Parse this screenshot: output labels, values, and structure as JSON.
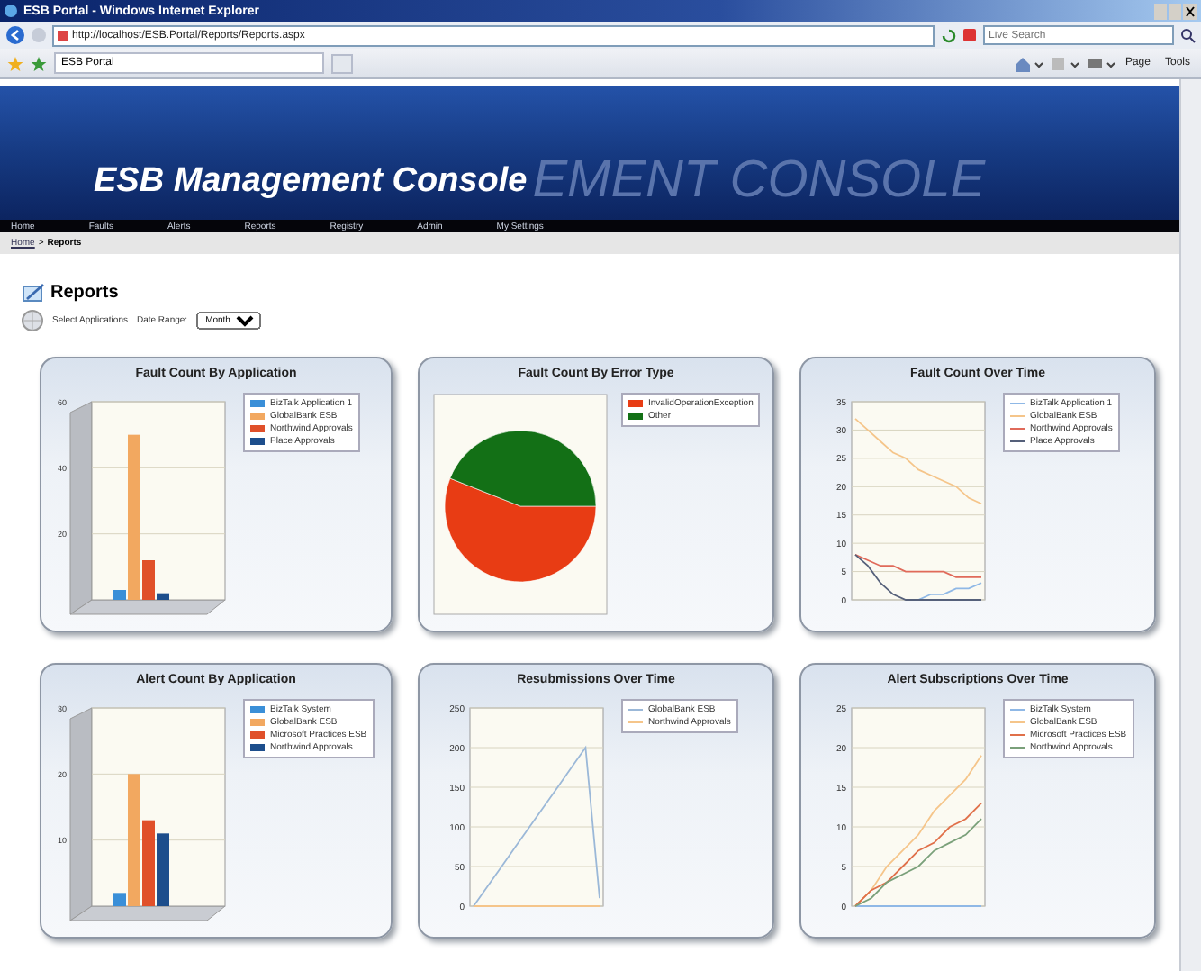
{
  "window": {
    "title": "ESB Portal - Windows Internet Explorer"
  },
  "address_bar": {
    "url": "http://localhost/ESB.Portal/Reports/Reports.aspx"
  },
  "search": {
    "placeholder": "Live Search"
  },
  "tab": {
    "label": "ESB Portal"
  },
  "toolbar": [
    "Page",
    "Tools"
  ],
  "banner": {
    "title": "ESB Management Console",
    "backdrop": "EMENT CONSOLE"
  },
  "nav": [
    "Home",
    "Faults",
    "Alerts",
    "Reports",
    "Registry",
    "Admin",
    "My Settings"
  ],
  "breadcrumb": {
    "link": "Home",
    "separator": ">",
    "current": "Reports"
  },
  "page": {
    "title": "Reports",
    "select_label": "Select Applications",
    "date_label": "Date Range:",
    "date_value": "Month"
  },
  "cards": [
    {
      "title": "Fault Count By Application",
      "chart_data": {
        "type": "bar",
        "grid": true,
        "legend": true,
        "ylim": [
          0,
          60
        ],
        "yticks": [
          20,
          40,
          60
        ],
        "series": [
          {
            "name": "BizTalk Application 1",
            "color": "#3a8fd8",
            "values": [
              3
            ]
          },
          {
            "name": "GlobalBank ESB",
            "color": "#f2a860",
            "values": [
              50
            ]
          },
          {
            "name": "Northwind Approvals",
            "color": "#e0502a",
            "values": [
              12
            ]
          },
          {
            "name": "Place Approvals",
            "color": "#1d4e8c",
            "values": [
              2
            ]
          }
        ]
      }
    },
    {
      "title": "Fault Count By Error Type",
      "chart_data": {
        "type": "pie",
        "legend": true,
        "categories": [
          "InvalidOperationException",
          "Other"
        ],
        "colors": [
          "#e83c14",
          "#137016"
        ],
        "values": [
          56,
          44
        ]
      }
    },
    {
      "title": "Fault Count Over Time",
      "chart_data": {
        "type": "line",
        "grid": true,
        "legend": true,
        "ylim": [
          0,
          35
        ],
        "yticks": [
          0,
          5,
          10,
          15,
          20,
          25,
          30,
          35
        ],
        "series": [
          {
            "name": "BizTalk Application 1",
            "color": "#8fb8e6",
            "values": [
              null,
              null,
              null,
              null,
              0,
              0,
              1,
              1,
              2,
              2,
              3
            ]
          },
          {
            "name": "GlobalBank ESB",
            "color": "#f5c58a",
            "values": [
              32,
              30,
              28,
              26,
              25,
              23,
              22,
              21,
              20,
              18,
              17
            ]
          },
          {
            "name": "Northwind Approvals",
            "color": "#e06a5a",
            "values": [
              8,
              7,
              6,
              6,
              5,
              5,
              5,
              5,
              4,
              4,
              4
            ]
          },
          {
            "name": "Place Approvals",
            "color": "#55607a",
            "values": [
              8,
              6,
              3,
              1,
              0,
              0,
              0,
              0,
              0,
              0,
              0
            ]
          }
        ]
      }
    },
    {
      "title": "Alert Count By Application",
      "chart_data": {
        "type": "bar",
        "grid": true,
        "legend": true,
        "ylim": [
          0,
          30
        ],
        "yticks": [
          10,
          20,
          30
        ],
        "series": [
          {
            "name": "BizTalk System",
            "color": "#3a8fd8",
            "values": [
              2
            ]
          },
          {
            "name": "GlobalBank ESB",
            "color": "#f2a860",
            "values": [
              20
            ]
          },
          {
            "name": "Microsoft Practices ESB",
            "color": "#e0502a",
            "values": [
              13
            ]
          },
          {
            "name": "Northwind Approvals",
            "color": "#1d4e8c",
            "values": [
              11
            ]
          }
        ]
      }
    },
    {
      "title": "Resubmissions Over Time",
      "chart_data": {
        "type": "line",
        "grid": true,
        "legend": true,
        "ylim": [
          0,
          250
        ],
        "yticks": [
          0,
          50,
          100,
          150,
          200,
          250
        ],
        "series": [
          {
            "name": "GlobalBank ESB",
            "color": "#9bb8d8",
            "values": [
              0,
              25,
              50,
              75,
              100,
              125,
              150,
              175,
              200,
              10
            ]
          },
          {
            "name": "Northwind Approvals",
            "color": "#f5c58a",
            "values": [
              0,
              0,
              0,
              0,
              0,
              0,
              0,
              0,
              0,
              0
            ]
          }
        ]
      }
    },
    {
      "title": "Alert Subscriptions Over Time",
      "chart_data": {
        "type": "line",
        "grid": true,
        "legend": true,
        "ylim": [
          0,
          25
        ],
        "yticks": [
          0,
          5,
          10,
          15,
          20,
          25
        ],
        "series": [
          {
            "name": "BizTalk System",
            "color": "#8fb8e6",
            "values": [
              0,
              0,
              0,
              0,
              0,
              0,
              0,
              0,
              0
            ]
          },
          {
            "name": "GlobalBank ESB",
            "color": "#f5c58a",
            "values": [
              0,
              2,
              5,
              7,
              9,
              12,
              14,
              16,
              19
            ]
          },
          {
            "name": "Microsoft Practices ESB",
            "color": "#e0704a",
            "values": [
              0,
              2,
              3,
              5,
              7,
              8,
              10,
              11,
              13
            ]
          },
          {
            "name": "Northwind Approvals",
            "color": "#7aa07a",
            "values": [
              0,
              1,
              3,
              4,
              5,
              7,
              8,
              9,
              11
            ]
          }
        ]
      }
    }
  ]
}
